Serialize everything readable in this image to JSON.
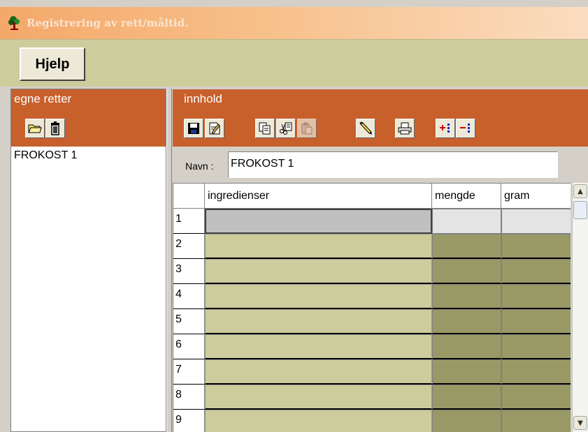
{
  "window": {
    "title": "Registrering av rett/måltid."
  },
  "toolbar": {
    "help_label": "Hjelp"
  },
  "left_panel": {
    "title": "egne retter",
    "items": [
      "FROKOST 1"
    ]
  },
  "right_panel": {
    "title": "innhold",
    "name_label": "Navn :",
    "name_value": "FROKOST 1"
  },
  "grid": {
    "columns": [
      "ingredienser",
      "mengde",
      "gram"
    ],
    "row_numbers": [
      "1",
      "2",
      "3",
      "4",
      "5",
      "6",
      "7",
      "8",
      "9"
    ]
  },
  "colors": {
    "header_orange": "#c8602c",
    "toolbar_olive": "#cccc9c",
    "cell_olive_dark": "#999966"
  }
}
